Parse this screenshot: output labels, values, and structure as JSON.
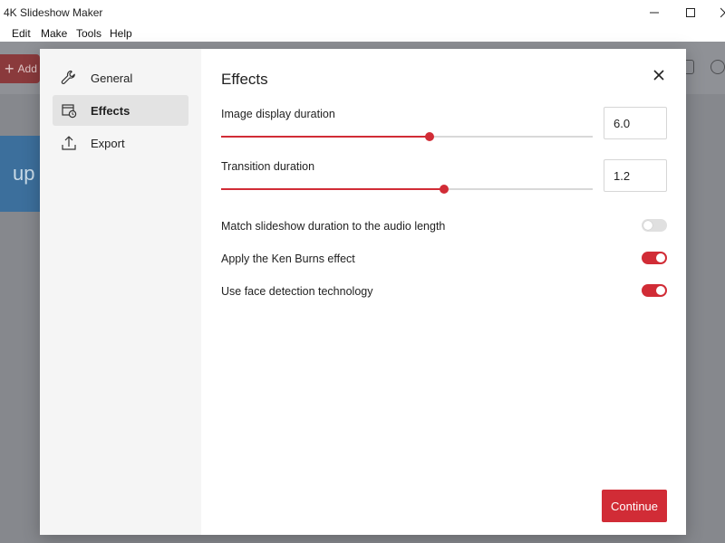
{
  "window": {
    "title": "4K Slideshow Maker",
    "controls": {
      "minimize": "—",
      "maximize": "□",
      "close": "✕"
    }
  },
  "menu": [
    "Edit",
    "Make",
    "Tools",
    "Help"
  ],
  "background": {
    "add_button_label": "Add",
    "upload_text": "up"
  },
  "dialog": {
    "nav": [
      {
        "label": "General",
        "icon": "wrench-icon"
      },
      {
        "label": "Effects",
        "icon": "effects-icon",
        "active": true
      },
      {
        "label": "Export",
        "icon": "export-icon"
      }
    ],
    "title": "Effects",
    "image_duration": {
      "label": "Image display duration",
      "value": "6.0",
      "slider_fraction": 0.56
    },
    "transition_duration": {
      "label": "Transition duration",
      "value": "1.2",
      "slider_fraction": 0.6
    },
    "options": [
      {
        "label": "Match slideshow duration to the audio length",
        "enabled": false
      },
      {
        "label": "Apply the Ken Burns effect",
        "enabled": true
      },
      {
        "label": "Use face detection technology",
        "enabled": true
      }
    ],
    "continue_label": "Continue"
  },
  "colors": {
    "accent": "#d12c36",
    "sidebar_bg": "#f5f5f5",
    "overlay": "#86888d"
  }
}
